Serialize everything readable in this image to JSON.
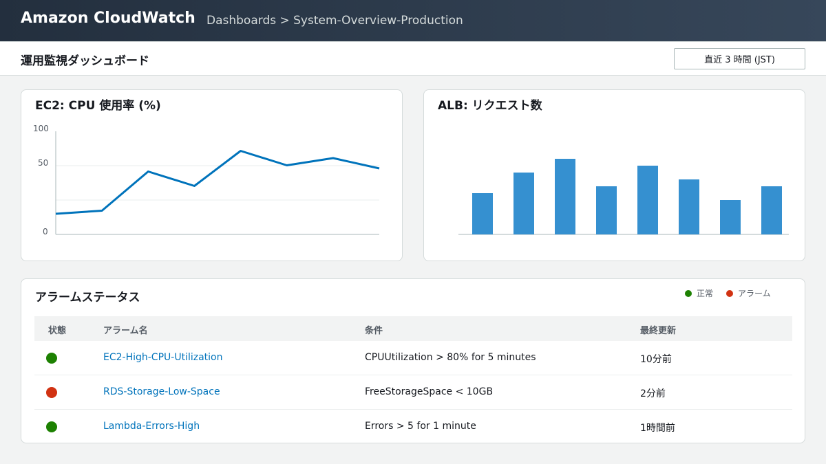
{
  "header": {
    "brand": "Amazon CloudWatch",
    "breadcrumb": "Dashboards > System-Overview-Production"
  },
  "subheader": {
    "title": "運用監視ダッシュボード",
    "time_range": "直近 3 時間 (JST)"
  },
  "widgets": {
    "cpu": {
      "title": "EC2: CPU 使用率 (%)"
    },
    "alb": {
      "title": "ALB: リクエスト数"
    }
  },
  "alarms": {
    "title": "アラームステータス",
    "legend": [
      {
        "label": "正常",
        "color": "#1d8102"
      },
      {
        "label": "アラーム",
        "color": "#d13212"
      }
    ],
    "columns": [
      "状態",
      "アラーム名",
      "条件",
      "最終更新"
    ],
    "rows": [
      {
        "status": "ok",
        "color": "#1d8102",
        "name": "EC2-High-CPU-Utilization",
        "condition": "CPUUtilization > 80% for 5 minutes",
        "updated": "10分前"
      },
      {
        "status": "alarm",
        "color": "#d13212",
        "name": "RDS-Storage-Low-Space",
        "condition": "FreeStorageSpace < 10GB",
        "updated": "2分前"
      },
      {
        "status": "ok",
        "color": "#1d8102",
        "name": "Lambda-Errors-High",
        "condition": "Errors > 5 for 1 minute",
        "updated": "1時間前"
      }
    ]
  },
  "chart_data": [
    {
      "type": "line",
      "title": "EC2: CPU 使用率 (%)",
      "x": [
        0,
        1,
        2,
        3,
        4,
        5,
        6,
        7
      ],
      "values": [
        20,
        23,
        61,
        47,
        81,
        67,
        74,
        64
      ],
      "ylim": [
        0,
        100
      ],
      "yticks": [
        "0",
        "50",
        "100"
      ],
      "color": "#0073bb",
      "grid": true
    },
    {
      "type": "bar",
      "title": "ALB: リクエスト数",
      "values": [
        60,
        90,
        110,
        70,
        100,
        80,
        50,
        70
      ],
      "ylim": [
        0,
        110
      ],
      "color": "#3590d0"
    }
  ]
}
